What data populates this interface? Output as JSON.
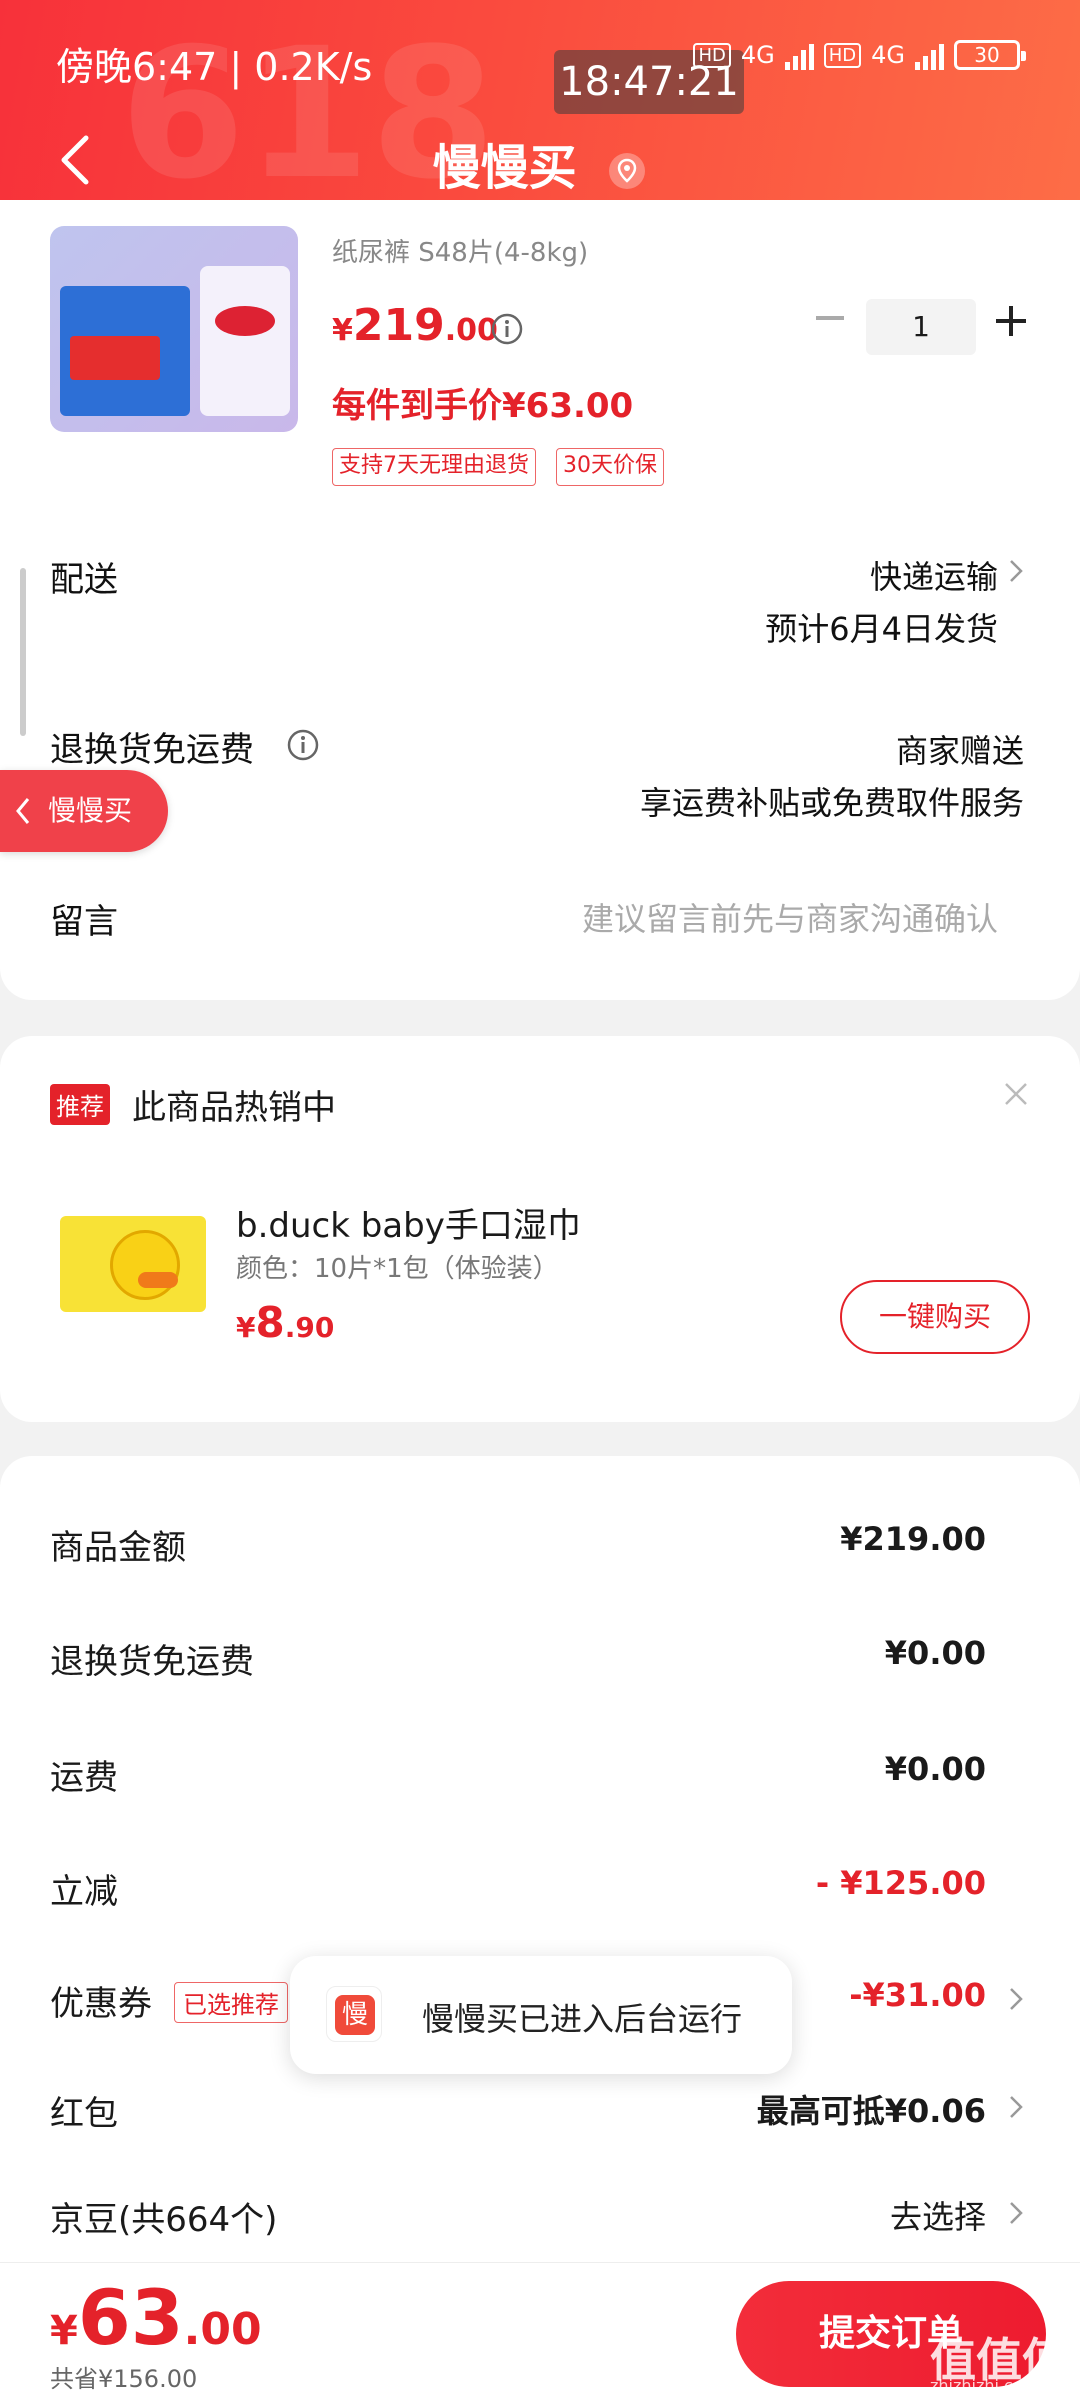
{
  "status_bar": {
    "time_text": "傍晚6:47 | 0.2K/s",
    "clock_overlay": "18:47:21",
    "network_1": "4G",
    "network_2": "4G",
    "hd_1": "HD",
    "hd_2": "HD",
    "battery": "30"
  },
  "header": {
    "title": "慢慢买",
    "decoration": "618"
  },
  "product": {
    "spec": "纸尿裤 S48片(4-8kg)",
    "price_symbol": "¥",
    "price_int": "219",
    "price_dec": ".00",
    "quantity": "1",
    "unit_price": "每件到手价¥63.00",
    "tags": [
      "支持7天无理由退货",
      "30天价保"
    ]
  },
  "rows": {
    "delivery_label": "配送",
    "delivery_method": "快递运输",
    "delivery_date": "预计6月4日发货",
    "return_label": "退换货免运费",
    "return_value": "商家赠送",
    "return_desc": "享运费补贴或免费取件服务",
    "message_label": "留言",
    "message_placeholder": "建议留言前先与商家沟通确认"
  },
  "float_back": {
    "label": "慢慢买"
  },
  "recommend": {
    "badge": "推荐",
    "title": "此商品热销中",
    "name": "b.duck baby手口湿巾",
    "spec": "颜色：10片*1包（体验装）",
    "price_symbol": "¥",
    "price_int": "8",
    "price_dec": ".90",
    "buy_button": "一键购买"
  },
  "summary": {
    "goods_label": "商品金额",
    "goods_value": "¥219.00",
    "return_label": "退换货免运费",
    "return_value": "¥0.00",
    "shipping_label": "运费",
    "shipping_value": "¥0.00",
    "discount_label": "立减",
    "discount_value": "- ¥125.00",
    "coupon_label": "优惠券",
    "coupon_badge": "已选推荐",
    "coupon_value": "-¥31.00",
    "redpacket_label": "红包",
    "redpacket_value": "最高可抵¥0.06",
    "jd_label": "京豆(共664个)",
    "jd_value": "去选择"
  },
  "toast": {
    "icon_char": "慢",
    "text": "慢慢买已进入后台运行"
  },
  "bottom": {
    "total_symbol": "¥",
    "total_int": "63",
    "total_dec": ".00",
    "saved": "共省¥156.00",
    "submit": "提交订单"
  },
  "watermark": {
    "text": "值值值",
    "sub": "zhizhizhi.com"
  },
  "colors": {
    "accent": "#e4222a",
    "header_start": "#f7313a",
    "header_end": "#fd6d47"
  }
}
